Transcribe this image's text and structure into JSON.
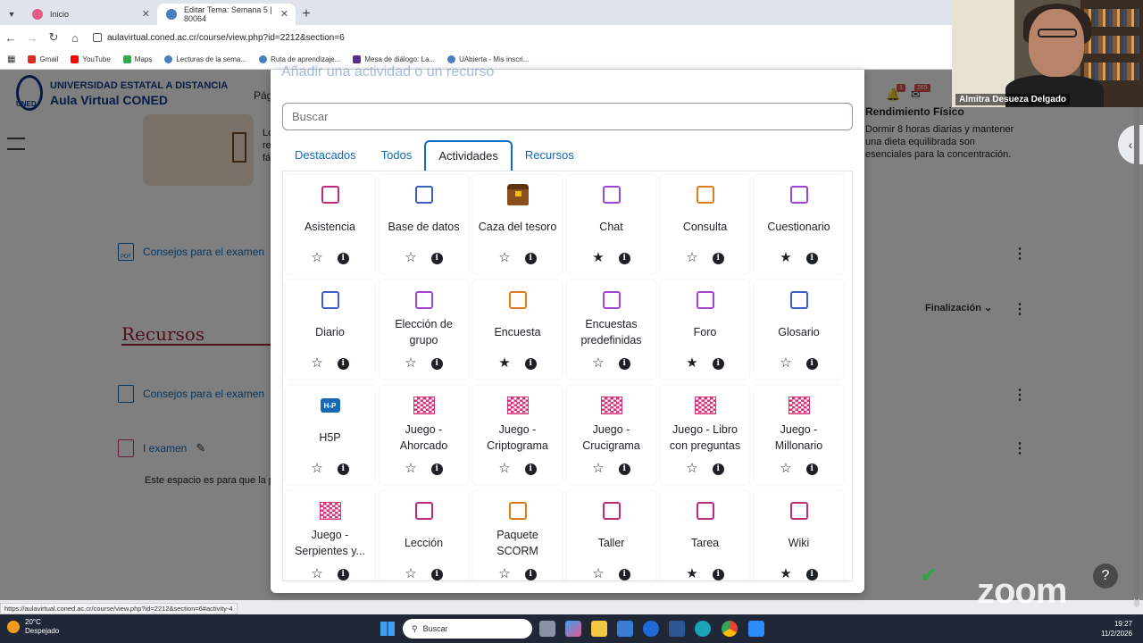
{
  "browser": {
    "tabs": [
      {
        "label": "Inicio",
        "active": false
      },
      {
        "label": "Editar Tema: Semana 5 | 80064",
        "active": true
      }
    ],
    "url": "aulavirtual.coned.ac.cr/course/view.php?id=2212&section=6",
    "bookmarks": [
      "Gmail",
      "YouTube",
      "Maps",
      "Lecturas de la sema...",
      "Ruta de aprendizaje...",
      "Mesa de diálogo: La...",
      "UAbierta - Mis inscri..."
    ],
    "status_url": "https://aulavirtual.coned.ac.cr/course/view.php?id=2212&section=6#activity-4"
  },
  "background_page": {
    "logo_line1": "UNIVERSIDAD ESTATAL A DISTANCIA",
    "logo_line2": "Aula Virtual CONED",
    "logo_abbrev": "UNED",
    "nav_cut": "Pág",
    "notif_count": "1",
    "msg_count": "265",
    "left_text_cut": [
      "Lo",
      "re",
      "fá"
    ],
    "right_panel_title": "Rendimiento Físico",
    "right_panel_text": "Dormir 8 horas diarias y mantener una dieta equilibrada son esenciales para la concentración.",
    "items": [
      {
        "label": "Consejos para el examen",
        "type": "pdf"
      },
      {
        "label": "Consejos para el examen",
        "type": "page"
      },
      {
        "label": "I examen",
        "type": "assign"
      }
    ],
    "section_heading": "Recursos",
    "completion_label": "Finalización",
    "exam_desc": "Este espacio es para que la pe"
  },
  "modal": {
    "title_cut": "Añadir una actividad o un recurso",
    "search_placeholder": "Buscar",
    "tabs": [
      "Destacados",
      "Todos",
      "Actividades",
      "Recursos"
    ],
    "active_tab": "Actividades",
    "activities": [
      {
        "name": "Asistencia",
        "icon": "attendance-icon",
        "starred": false
      },
      {
        "name": "Base de datos",
        "icon": "database-icon",
        "starred": false
      },
      {
        "name": "Caza del tesoro",
        "icon": "treasure-chest-icon",
        "starred": false
      },
      {
        "name": "Chat",
        "icon": "chat-icon",
        "starred": true
      },
      {
        "name": "Consulta",
        "icon": "choice-icon",
        "starred": false
      },
      {
        "name": "Cuestionario",
        "icon": "quiz-icon",
        "starred": true
      },
      {
        "name": "Diario",
        "icon": "journal-icon",
        "starred": false
      },
      {
        "name": "Elección de grupo",
        "icon": "group-choice-icon",
        "starred": false
      },
      {
        "name": "Encuesta",
        "icon": "feedback-icon",
        "starred": true
      },
      {
        "name": "Encuestas predefinidas",
        "icon": "survey-icon",
        "starred": false
      },
      {
        "name": "Foro",
        "icon": "forum-icon",
        "starred": true
      },
      {
        "name": "Glosario",
        "icon": "glossary-icon",
        "starred": false
      },
      {
        "name": "H5P",
        "icon": "h5p-icon",
        "starred": false
      },
      {
        "name": "Juego - Ahorcado",
        "icon": "game-icon",
        "starred": false
      },
      {
        "name": "Juego - Criptograma",
        "icon": "game-icon",
        "starred": false
      },
      {
        "name": "Juego - Crucigrama",
        "icon": "game-icon",
        "starred": false
      },
      {
        "name": "Juego - Libro con preguntas",
        "icon": "game-icon",
        "starred": false
      },
      {
        "name": "Juego - Millonario",
        "icon": "game-icon",
        "starred": false
      },
      {
        "name": "Juego - Serpientes y...",
        "icon": "game-icon",
        "starred": false
      },
      {
        "name": "Lección",
        "icon": "lesson-icon",
        "starred": false
      },
      {
        "name": "Paquete SCORM",
        "icon": "scorm-icon",
        "starred": false
      },
      {
        "name": "Taller",
        "icon": "workshop-icon",
        "starred": false
      },
      {
        "name": "Tarea",
        "icon": "assignment-icon",
        "starred": true
      },
      {
        "name": "Wiki",
        "icon": "wiki-icon",
        "starred": true
      }
    ]
  },
  "video": {
    "participant_name": "Almitra Desueza Delgado",
    "watermark": "zoom"
  },
  "taskbar": {
    "temperature": "20°C",
    "weather": "Despejado",
    "search_label": "Buscar",
    "time": "19:27",
    "date": "11/2/2026"
  },
  "colors": {
    "accent": "#0f6cbf",
    "activity_purple": "#a044d6",
    "game_pink": "#d6327a",
    "recursos_red": "#a02033"
  }
}
